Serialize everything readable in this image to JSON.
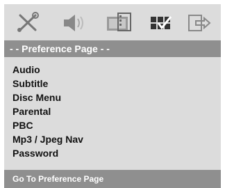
{
  "icons": [
    {
      "name": "settings-icon"
    },
    {
      "name": "speaker-icon"
    },
    {
      "name": "video-icon"
    },
    {
      "name": "preference-icon"
    },
    {
      "name": "exit-icon"
    }
  ],
  "title_bar": {
    "label": "- -  Preference Page  - -"
  },
  "menu": {
    "items": [
      {
        "label": "Audio"
      },
      {
        "label": "Subtitle"
      },
      {
        "label": "Disc Menu"
      },
      {
        "label": "Parental"
      },
      {
        "label": "PBC"
      },
      {
        "label": "Mp3 / Jpeg Nav"
      },
      {
        "label": "Password"
      }
    ]
  },
  "status_bar": {
    "label": "Go To Preference Page"
  },
  "colors": {
    "background": "#dcdcdc",
    "bar": "#8f8f8f",
    "bar_text": "#ffffff",
    "text": "#111111"
  }
}
